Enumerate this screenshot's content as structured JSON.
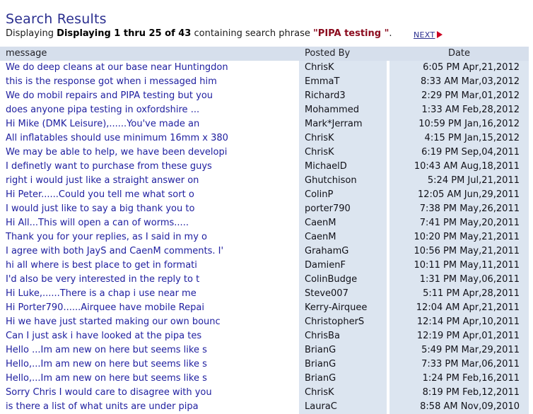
{
  "page_title": "Search Results",
  "summary": {
    "prefix": "Displaying ",
    "strong": "Displaying 1 thru 25 of 43",
    "middle": " containing search phrase ",
    "phrase": "\"PIPA testing \"",
    "suffix": "."
  },
  "pagination": {
    "next_label": "NEXT",
    "next_arrow_icon": "right-triangle-icon"
  },
  "table": {
    "columns": [
      "message",
      "Posted By",
      "Date"
    ],
    "rows": [
      {
        "message": "We do deep cleans at our base near Huntingdon",
        "posted_by": "ChrisK",
        "date": "6:05 PM Apr,21,2012"
      },
      {
        "message": "this is the response got when i messaged him",
        "posted_by": "EmmaT",
        "date": "8:33 AM Mar,03,2012"
      },
      {
        "message": "We do mobil repairs and PIPA testing but you",
        "posted_by": "Richard3",
        "date": "2:29 PM Mar,01,2012"
      },
      {
        "message": "does anyone pipa testing in oxfordshire ...",
        "posted_by": "Mohammed",
        "date": "1:33 AM Feb,28,2012"
      },
      {
        "message": "Hi Mike (DMK Leisure),......You've made an",
        "posted_by": "Mark*Jerram",
        "date": "10:59 PM Jan,16,2012"
      },
      {
        "message": "All inflatables should use minimum 16mm x 380",
        "posted_by": "ChrisK",
        "date": "4:15 PM Jan,15,2012"
      },
      {
        "message": "We may be able to help, we have been developi",
        "posted_by": "ChrisK",
        "date": "6:19 PM Sep,04,2011"
      },
      {
        "message": "I definetly want to purchase from these guys",
        "posted_by": "MichaelD",
        "date": "10:43 AM Aug,18,2011"
      },
      {
        "message": "right i would just like a straight answer on",
        "posted_by": "Ghutchison",
        "date": "5:24 PM Jul,21,2011"
      },
      {
        "message": "Hi Peter......Could you tell me what sort o",
        "posted_by": "ColinP",
        "date": "12:05 AM Jun,29,2011"
      },
      {
        "message": "I would just like to say a big thank you to",
        "posted_by": "porter790",
        "date": "7:38 PM May,26,2011"
      },
      {
        "message": "Hi All...This will open a can of worms.....",
        "posted_by": "CaenM",
        "date": "7:41 PM May,20,2011"
      },
      {
        "message": "Thank you for your replies, as I said in my o",
        "posted_by": "CaenM",
        "date": "10:20 PM May,21,2011"
      },
      {
        "message": "I agree with both JayS and CaenM comments. I'",
        "posted_by": "GrahamG",
        "date": "10:56 PM May,21,2011"
      },
      {
        "message": "hi all where is best place to get in formati",
        "posted_by": "DamienF",
        "date": "10:11 PM May,11,2011"
      },
      {
        "message": "I'd also be very interested in the reply to t",
        "posted_by": "ColinBudge",
        "date": "1:31 PM May,06,2011"
      },
      {
        "message": "Hi Luke,......There is a chap i use near me",
        "posted_by": "Steve007",
        "date": "5:11 PM Apr,28,2011"
      },
      {
        "message": "Hi Porter790......Airquee have mobile Repai",
        "posted_by": "Kerry-Airquee",
        "date": "12:04 AM Apr,21,2011"
      },
      {
        "message": "Hi we have just started making our own bounc",
        "posted_by": "ChristopherS",
        "date": "12:14 PM Apr,10,2011"
      },
      {
        "message": "Can I just ask i have looked at the pipa tes",
        "posted_by": "ChrisBa",
        "date": "12:19 PM Apr,01,2011"
      },
      {
        "message": "Hello ...Im am new on here but seems like s",
        "posted_by": "BrianG",
        "date": "5:49 PM Mar,29,2011"
      },
      {
        "message": "Hello,...Im am new on here but seems like s",
        "posted_by": "BrianG",
        "date": "7:33 PM Mar,06,2011"
      },
      {
        "message": "Hello,...Im am new on here but seems like s",
        "posted_by": "BrianG",
        "date": "1:24 PM Feb,16,2011"
      },
      {
        "message": "Sorry Chris I would care to disagree with you",
        "posted_by": "ChrisK",
        "date": "8:19 PM Feb,12,2011"
      },
      {
        "message": "is there a list of what units are under pipa",
        "posted_by": "LauraC",
        "date": "8:58 AM Nov,09,2010"
      }
    ]
  },
  "colors": {
    "title": "#2b2f8f",
    "message_text": "#2020a0",
    "phrase": "#8b0b1e",
    "header_bg": "#d6dfec",
    "cell_bg": "#dce5f0",
    "link": "#2b2f8f",
    "arrow": "#cc0022"
  }
}
